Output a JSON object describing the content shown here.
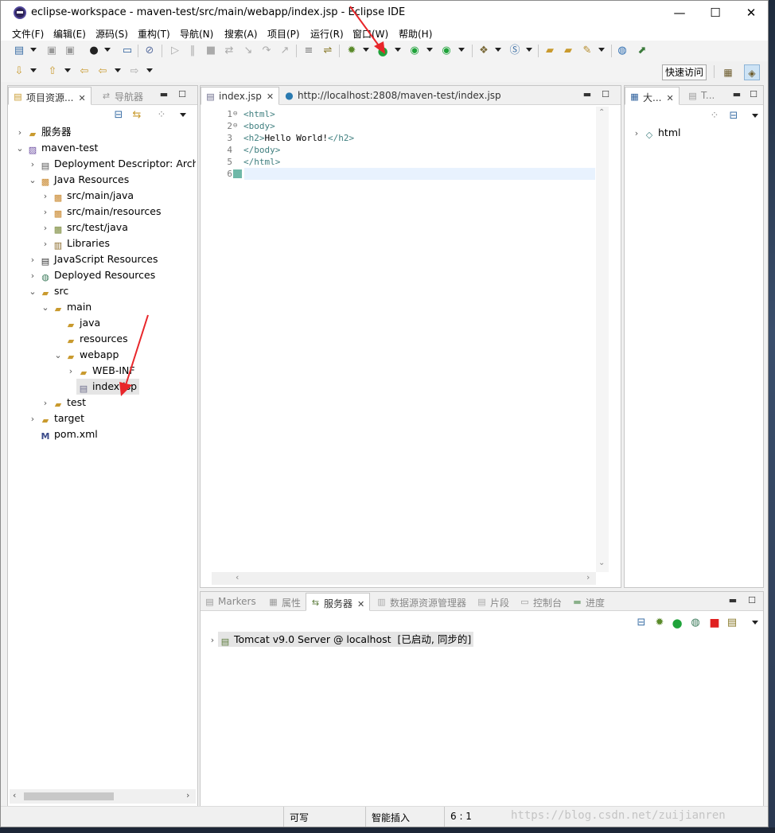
{
  "window": {
    "title": "eclipse-workspace - maven-test/src/main/webapp/index.jsp - Eclipse IDE",
    "minimize": "—",
    "maximize": "☐",
    "close": "✕"
  },
  "menu": [
    "文件(F)",
    "编辑(E)",
    "源码(S)",
    "重构(T)",
    "导航(N)",
    "搜索(A)",
    "项目(P)",
    "运行(R)",
    "窗口(W)",
    "帮助(H)"
  ],
  "toolbar": {
    "quick_access": "快速访问"
  },
  "left_panel": {
    "tabs": [
      {
        "label": "项目资源...",
        "close": "✕"
      },
      {
        "label": "导航器"
      }
    ],
    "tree": [
      {
        "label": "服务器"
      },
      {
        "label": "maven-test"
      },
      {
        "label": "Deployment Descriptor: Archetype Created Web Application"
      },
      {
        "label": "Java Resources"
      },
      {
        "label": "src/main/java"
      },
      {
        "label": "src/main/resources"
      },
      {
        "label": "src/test/java"
      },
      {
        "label": "Libraries"
      },
      {
        "label": "JavaScript Resources"
      },
      {
        "label": "Deployed Resources"
      },
      {
        "label": "src"
      },
      {
        "label": "main"
      },
      {
        "label": "java"
      },
      {
        "label": "resources"
      },
      {
        "label": "webapp"
      },
      {
        "label": "WEB-INF"
      },
      {
        "label": "index.jsp"
      },
      {
        "label": "test"
      },
      {
        "label": "target"
      },
      {
        "label": "pom.xml"
      }
    ]
  },
  "editor": {
    "tabs": [
      {
        "label": "index.jsp",
        "close": "✕"
      },
      {
        "label": "http://localhost:2808/maven-test/index.jsp"
      }
    ],
    "lines": [
      {
        "no": "1",
        "fold": "⊖",
        "open": "<html>",
        "text": "",
        "close": ""
      },
      {
        "no": "2",
        "fold": "⊖",
        "open": "<body>",
        "text": "",
        "close": ""
      },
      {
        "no": "3",
        "fold": "",
        "open": "<h2>",
        "text": "Hello World!",
        "close": "</h2>"
      },
      {
        "no": "4",
        "fold": "",
        "open": "</body>",
        "text": "",
        "close": ""
      },
      {
        "no": "5",
        "fold": "",
        "open": "</html>",
        "text": "",
        "close": ""
      },
      {
        "no": "6",
        "fold": "",
        "open": "",
        "text": "",
        "close": ""
      }
    ]
  },
  "outline_panel": {
    "tabs": [
      {
        "label": "大...",
        "close": "✕"
      },
      {
        "label": "T..."
      }
    ],
    "tree": [
      {
        "label": "html"
      }
    ]
  },
  "bottom_panel": {
    "tabs": [
      {
        "label": "Markers"
      },
      {
        "label": "属性"
      },
      {
        "label": "服务器",
        "close": "✕"
      },
      {
        "label": "数据源资源管理器"
      },
      {
        "label": "片段"
      },
      {
        "label": "控制台"
      },
      {
        "label": "进度"
      }
    ],
    "server": {
      "label": "Tomcat v9.0 Server @ localhost",
      "state": "[已启动, 同步的]"
    }
  },
  "statusbar": {
    "writable": "可写",
    "insert_mode": "智能插入",
    "position": "6 : 1"
  },
  "watermark": "https://blog.csdn.net/zuijianren",
  "colors": {
    "run_green": "#1fa33a",
    "stop_red": "#e02020",
    "tag_teal": "#3f7f7f",
    "arrow_red": "#e8262a"
  }
}
